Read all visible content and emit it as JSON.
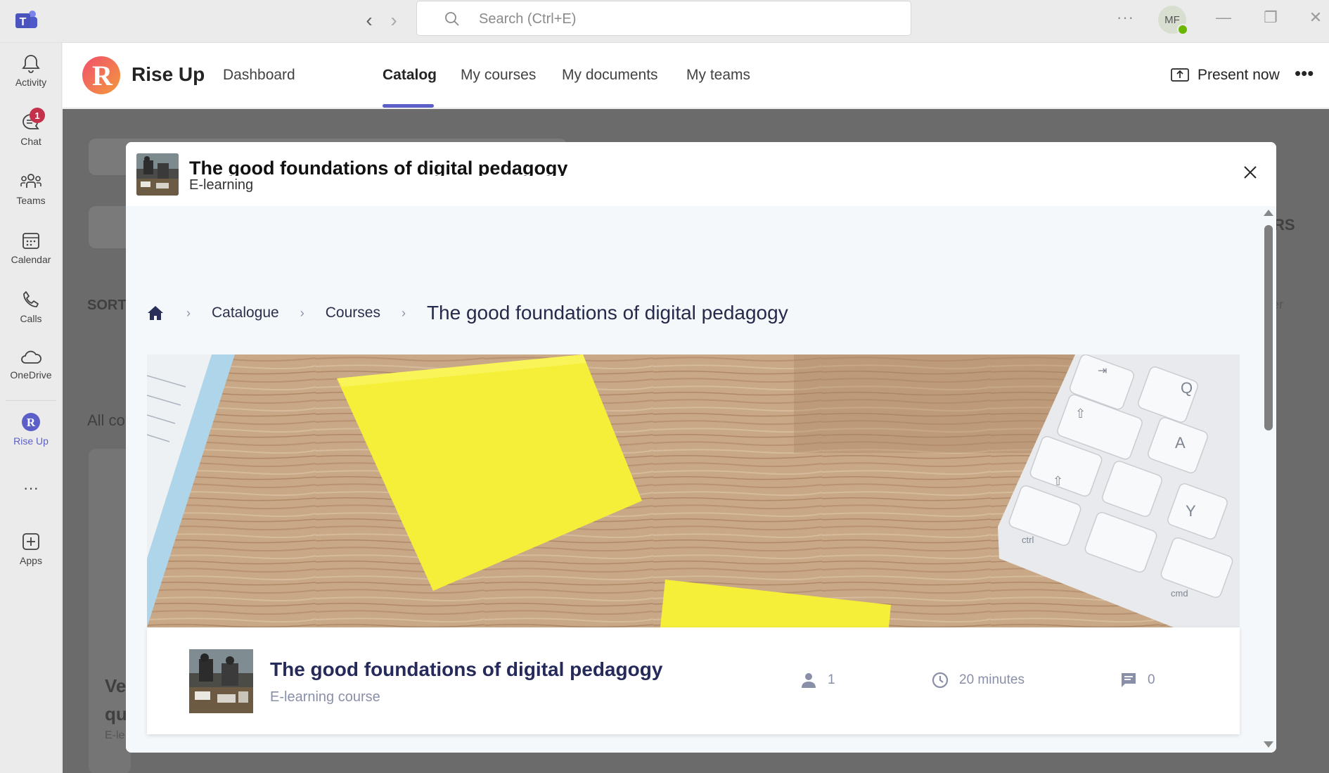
{
  "titlebar": {
    "search_placeholder": "Search (Ctrl+E)",
    "more_label": "···",
    "avatar_initials": "MF"
  },
  "rail": {
    "items": [
      {
        "label": "Activity",
        "icon": "bell-icon"
      },
      {
        "label": "Chat",
        "icon": "chat-icon",
        "badge": "1"
      },
      {
        "label": "Teams",
        "icon": "teams-icon"
      },
      {
        "label": "Calendar",
        "icon": "calendar-icon"
      },
      {
        "label": "Calls",
        "icon": "phone-icon"
      },
      {
        "label": "OneDrive",
        "icon": "cloud-icon"
      },
      {
        "label": "Rise Up",
        "icon": "riseup-icon",
        "active": true
      },
      {
        "label": "···",
        "icon": "more-icon"
      },
      {
        "label": "Apps",
        "icon": "plus-box-icon"
      }
    ]
  },
  "app": {
    "name": "Rise Up",
    "logo_letter": "R",
    "tabs": [
      {
        "label": "Dashboard"
      },
      {
        "label": "Catalog",
        "active": true
      },
      {
        "label": "My courses"
      },
      {
        "label": "My documents"
      },
      {
        "label": "My teams"
      }
    ],
    "present_label": "Present now",
    "more_label": "•••",
    "accent": "#5b5fc7"
  },
  "background": {
    "sort_label": "SORT",
    "all_label": "All co",
    "rs_label": "RS",
    "order_label": "der",
    "card_title_fragment": "Ve\nqu",
    "card_sub_fragment": "E-le"
  },
  "modal": {
    "title": "The good foundations of digital pedagogy",
    "subtitle": "E-learning",
    "breadcrumb": {
      "home_icon": "home-icon",
      "items": [
        "Catalogue",
        "Courses",
        "The good foundations of digital pedagogy"
      ]
    },
    "course": {
      "title": "The good foundations of digital pedagogy",
      "type": "E-learning course",
      "learners": "1",
      "duration": "20 minutes",
      "comments": "0"
    }
  }
}
